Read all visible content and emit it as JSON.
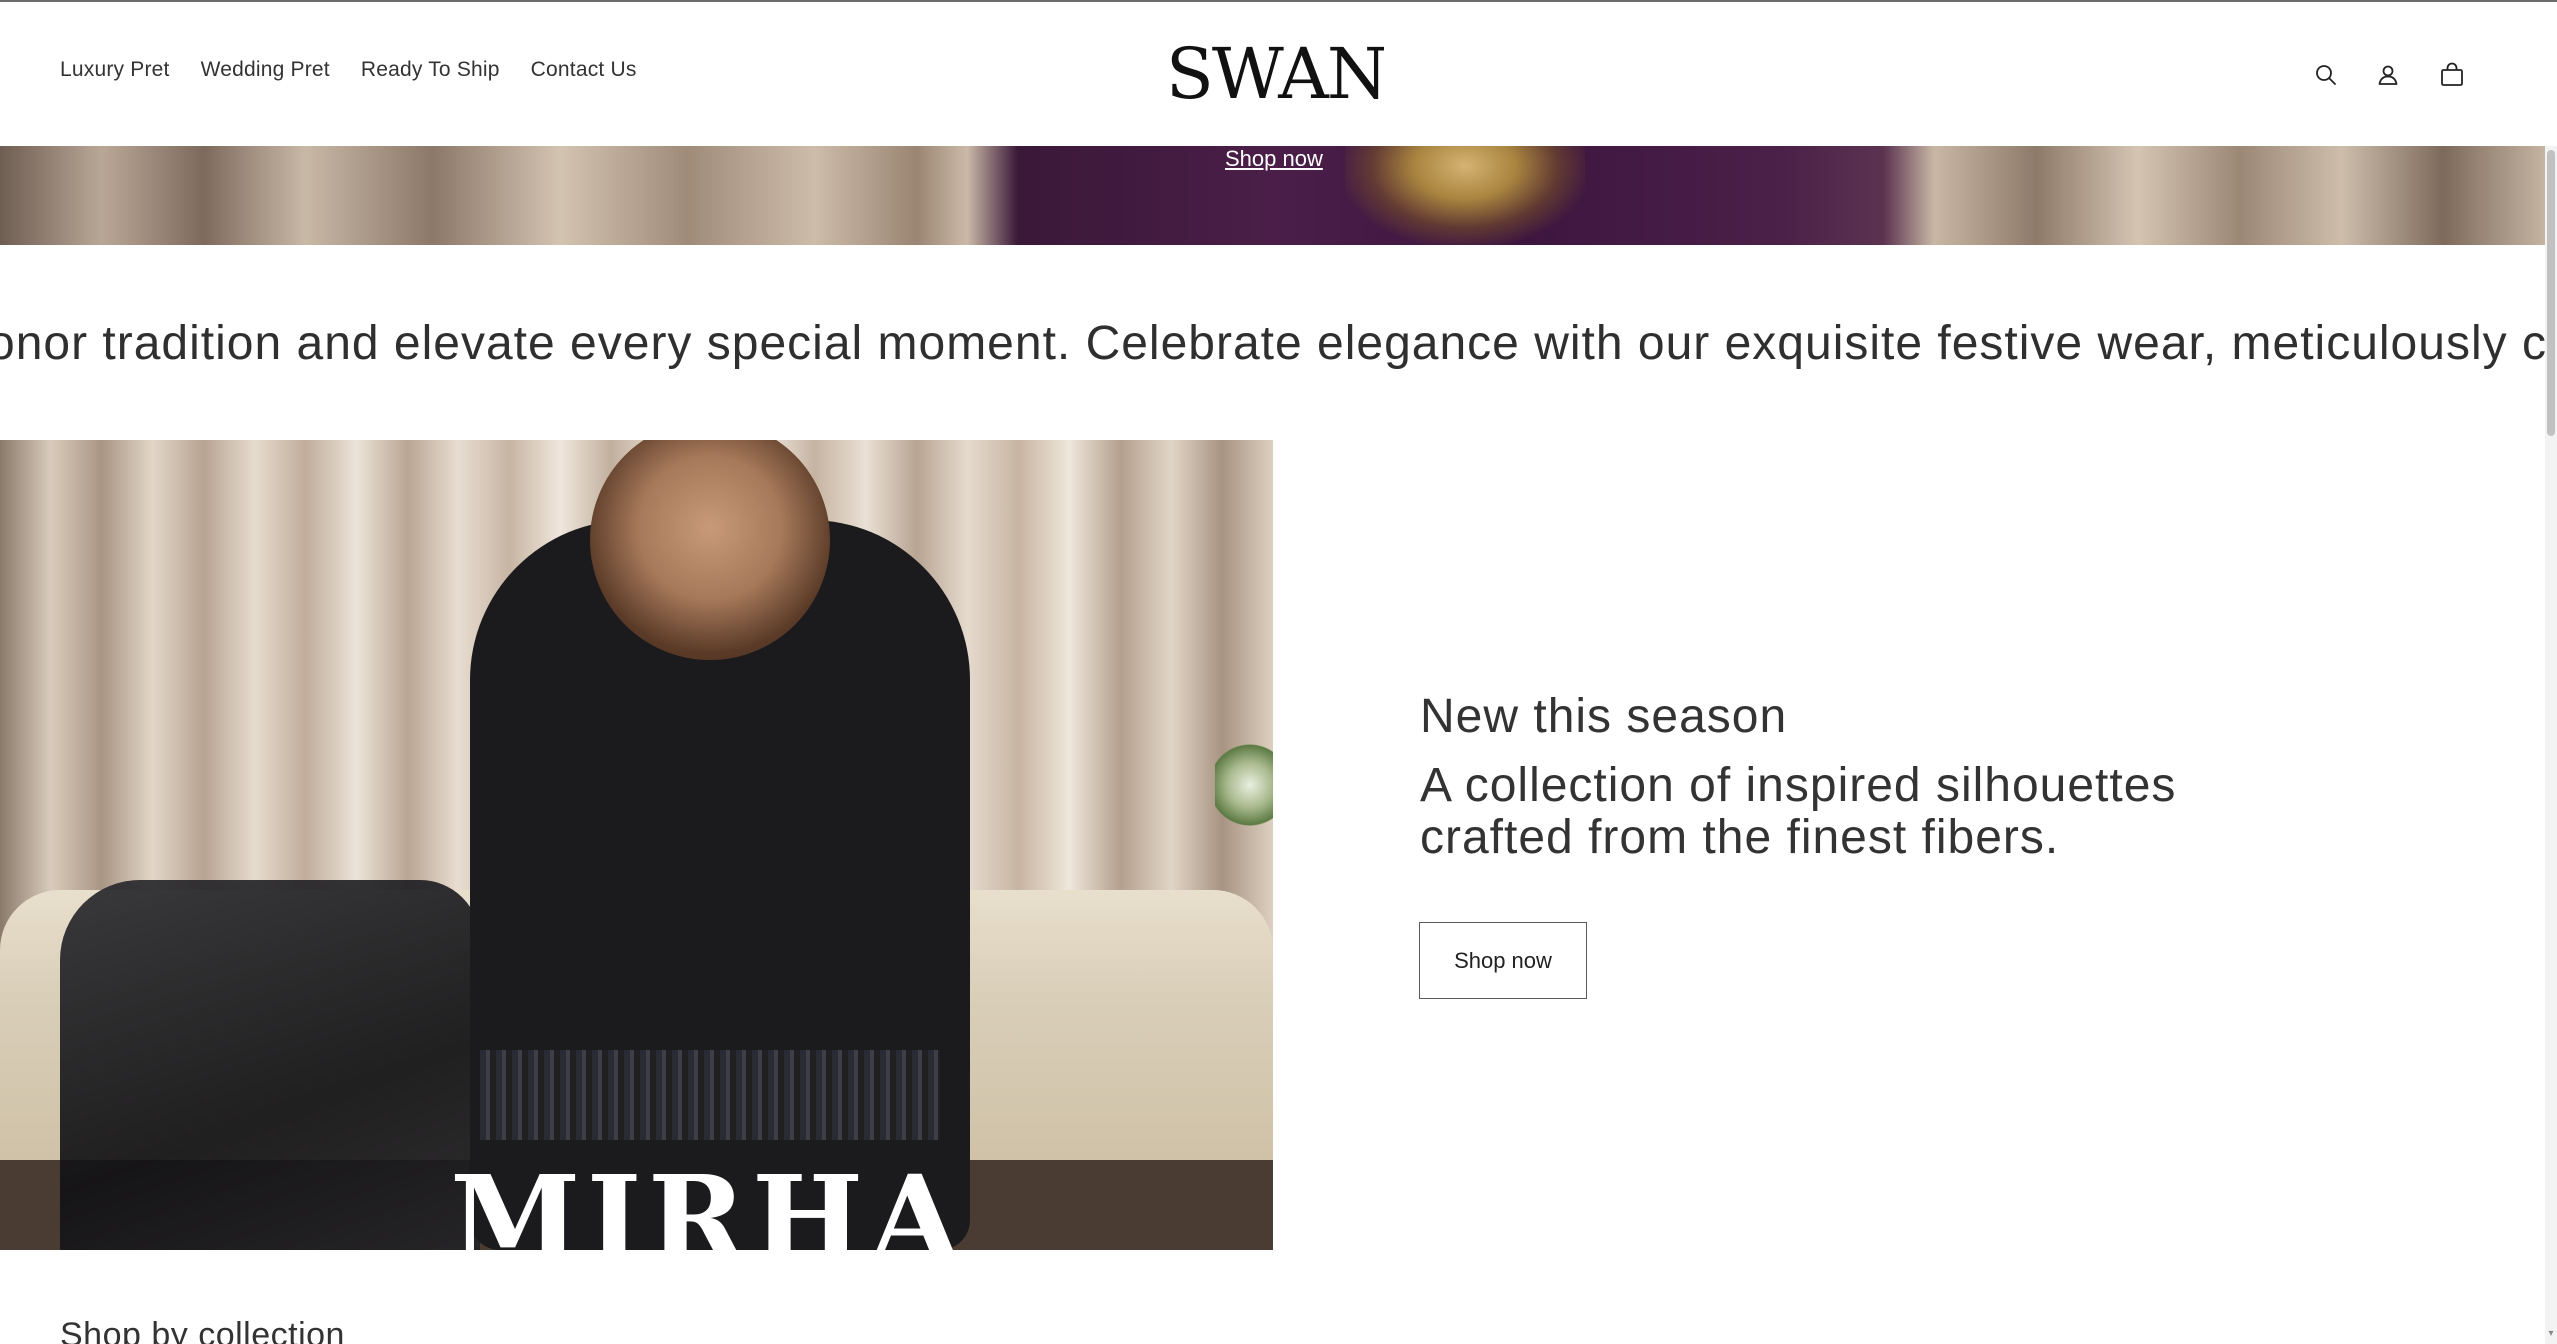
{
  "brand": {
    "logo_text": "SWAN"
  },
  "nav": {
    "items": [
      {
        "label": "Luxury Pret"
      },
      {
        "label": "Wedding Pret"
      },
      {
        "label": "Ready To Ship"
      },
      {
        "label": "Contact Us"
      }
    ]
  },
  "header_icons": [
    "search-icon",
    "account-icon",
    "cart-icon"
  ],
  "hero": {
    "button_label": "Shop now"
  },
  "marquee": {
    "text": "onor tradition and elevate every special moment.  Celebrate elegance with our exquisite festive wear, meticulously cr"
  },
  "feature": {
    "image_brand_text": "MIRHA",
    "subheading": "New this season",
    "heading_line1": "A collection of inspired silhouettes",
    "heading_line2": "crafted from the finest fibers.",
    "button_label": "Shop now"
  },
  "collections": {
    "heading": "Shop by collection"
  },
  "colors": {
    "text": "#333333",
    "background": "#ffffff",
    "button_border": "#5a5a5a"
  }
}
